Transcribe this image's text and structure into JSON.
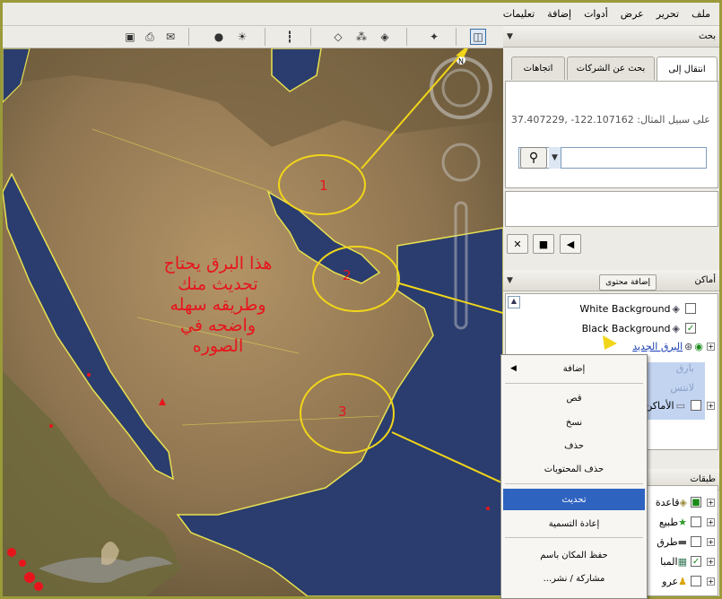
{
  "menu": [
    "ملف",
    "تحرير",
    "عرض",
    "أدوات",
    "إضافة",
    "تعليمات"
  ],
  "search_panel": {
    "title": "بحث",
    "tabs": [
      "انتقال إلى",
      "بحث عن الشركات",
      "اتجاهات"
    ],
    "hint_label": "على سبيل المثال:",
    "hint_value": "37.407229, -122.107162"
  },
  "places_panel": {
    "title": "أماكن",
    "add_content": "إضافة محتوى",
    "items": [
      {
        "label": "White Background",
        "checked": false
      },
      {
        "label": "Black Background",
        "checked": true
      },
      {
        "label": "البرق الجديد",
        "checked": true
      },
      {
        "label": "الأماكن",
        "checked": false
      }
    ],
    "selected_desc_1": "بارق",
    "selected_desc_2": "لانتس"
  },
  "layers_panel": {
    "title": "طبقات",
    "items": [
      "قاعدة",
      "طبيع",
      "طرق",
      "المبا",
      "عرو"
    ]
  },
  "context_menu": {
    "items": [
      "إضافة",
      "قص",
      "نسخ",
      "حذف",
      "حذف المحتويات",
      "تحديث",
      "إعادة التسمية",
      "حفظ المكان باسم",
      "مشاركة / نشر..."
    ],
    "selected": "تحديث"
  },
  "annotation": {
    "lines": [
      "هذا البرق يحتاج",
      "تحديث منك",
      "وطريقه سهله",
      "واضحه في",
      "الصوره"
    ],
    "markers": [
      "1",
      "2",
      "3"
    ]
  },
  "compass_label": "N",
  "colors": {
    "annotation": "#e8141c",
    "callout": "#f1d51a",
    "border": "#e8e050",
    "selection": "#2f63c0"
  }
}
